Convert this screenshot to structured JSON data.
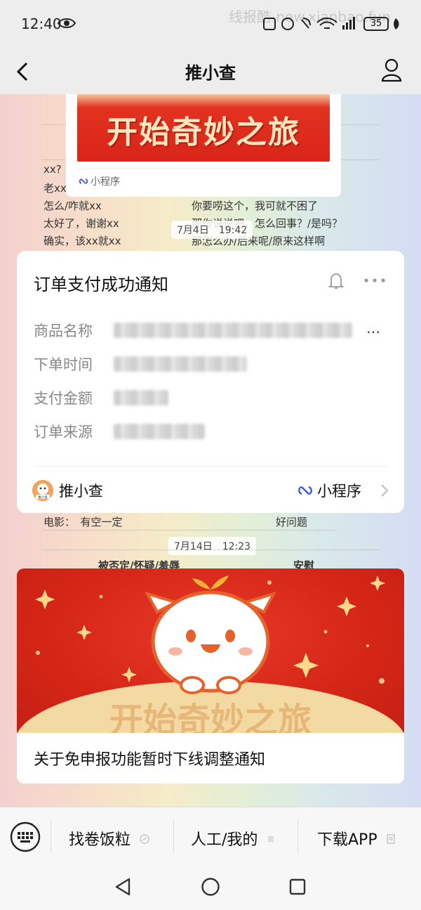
{
  "status_bar": {
    "time": "12:40",
    "watermark": "线报酷-new.xianbao.fun",
    "battery": "35"
  },
  "nav": {
    "title": "推小查"
  },
  "background_text": {
    "left_lines": [
      "xx?",
      "老xx",
      "怎么/咋就xx",
      "太好了，谢谢xx",
      "确实，该xx就xx"
    ],
    "right_lines": [
      "你要唠这个，我可就不困了",
      "那你说说吧，怎么回事？/是吗？",
      "那怎么办/后来呢/原来这样啊"
    ],
    "row_movie_left": "电影：　有空一定",
    "row_movie_right": "好问题",
    "row_header_left": "被否定/怀疑/羞辱",
    "row_header_right": "安慰"
  },
  "timestamps": [
    "7月4日　19:42",
    "7月14日　12:23"
  ],
  "mini_card": {
    "banner_text": "开始奇妙之旅",
    "label": "小程序"
  },
  "notification": {
    "title": "订单支付成功通知",
    "fields": [
      {
        "label": "商品名称",
        "value_trailing": "…"
      },
      {
        "label": "下单时间"
      },
      {
        "label": "支付金额"
      },
      {
        "label": "订单来源"
      }
    ],
    "source_name": "推小查",
    "logo_text": "推小查",
    "mini_program": "小程序"
  },
  "article": {
    "banner_text": "开始奇妙之旅",
    "title": "关于免申报功能暂时下线调整通知"
  },
  "bottom_menu": {
    "items": [
      "找卷饭粒",
      "人工/我的",
      "下载APP"
    ]
  },
  "colors": {
    "banner_red": "#d9251a",
    "link_blue": "#3b5bdb"
  }
}
